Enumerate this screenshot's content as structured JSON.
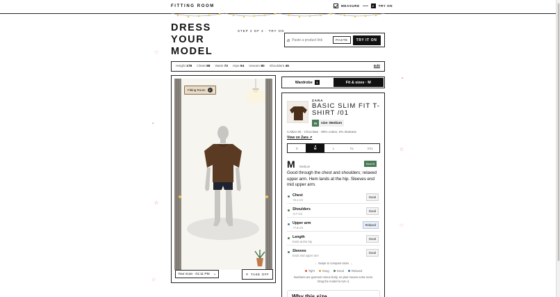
{
  "app": {
    "brand": "FITTING ROOM"
  },
  "nav": {
    "measure": "MEASURE",
    "step_num": "2",
    "try_on": "TRY ON"
  },
  "hero": {
    "line1": "DRESS",
    "line2": "YOUR",
    "line3": "MODEL",
    "step": "STEP 2 OF 2 · TRY ON"
  },
  "link_input": {
    "placeholder": "Paste a product link",
    "paste": "PASTE",
    "try_it_on": "TRY IT ON"
  },
  "measurements": {
    "items": [
      {
        "label": "Height",
        "value": "178"
      },
      {
        "label": "Chest",
        "value": "88"
      },
      {
        "label": "Waist",
        "value": "73"
      },
      {
        "label": "Hips",
        "value": "94"
      },
      {
        "label": "Inseam",
        "value": "80"
      },
      {
        "label": "Shoulders",
        "value": "45"
      }
    ],
    "edit": "Edit"
  },
  "room": {
    "tag": "Fitting Room",
    "tag_count": "2",
    "scan_select": "Your scan · 01:11 PM",
    "take_off": "TAKE OFF"
  },
  "tabs": {
    "wardrobe": "Wardrobe",
    "wardrobe_count": "1",
    "fit": "Fit & sizes · M"
  },
  "product": {
    "brand": "ZARA",
    "title": "BASIC SLIM FIT T-SHIRT /01",
    "size_badge": "M",
    "size_label": "size: Medium",
    "meta": "CA$22.90 · Chocolate · 95% cotton, 5% elastane",
    "view_link": "View on Zara ↗",
    "sizes": [
      "S",
      "M",
      "L",
      "XL",
      "XXL"
    ],
    "selected_size_index": 1
  },
  "fit": {
    "size_big": "M",
    "size_word": "Medium",
    "best_fit": "Best fit",
    "description": "Good through the chest and shoulders; relaxed upper arm. Hem lands at the hip. Sleeves end mid upper arm.",
    "rows": [
      {
        "name": "Chest",
        "sub": "+5.1 cm",
        "status": "Good"
      },
      {
        "name": "Shoulders",
        "sub": "-0.7 cm",
        "status": "Good"
      },
      {
        "name": "Upper arm",
        "sub": "+7.6 cm",
        "status": "Relaxed"
      },
      {
        "name": "Length",
        "sub": "Ends at the hip",
        "status": "Good"
      },
      {
        "name": "Sleeves",
        "sub": "Ends mid upper arm",
        "status": "Good"
      }
    ],
    "swipe": "←  Swipe to compare sizes  →",
    "legend": [
      {
        "label": "Tight",
        "color": "#d9534f"
      },
      {
        "label": "Snug",
        "color": "#e0a030"
      },
      {
        "label": "Good",
        "color": "#4a7a55"
      },
      {
        "label": "Relaxed",
        "color": "#4a78b0"
      }
    ],
    "note_line1": "Numbers are garment minus body, so plus means extra room.",
    "note_line2": "Drag the model to turn it.",
    "why_title": "Why this size"
  },
  "colors": {
    "accent": "#111111",
    "good": "#4a7a55",
    "relaxed": "#4a78b0",
    "shirt": "#5a3a22"
  }
}
